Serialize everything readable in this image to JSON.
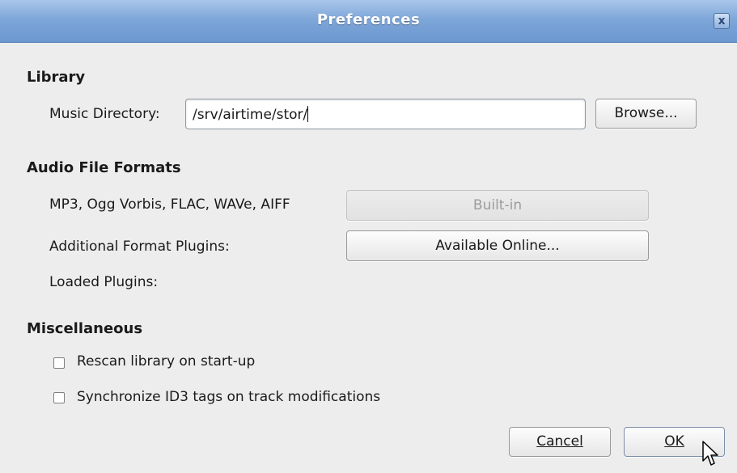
{
  "window": {
    "title": "Preferences",
    "close_icon": "x"
  },
  "library": {
    "heading": "Library",
    "music_dir_label": "Music Directory:",
    "music_dir_value": "/srv/airtime/stor/",
    "browse_label": "Browse..."
  },
  "audio": {
    "heading": "Audio File Formats",
    "formats_label": "MP3, Ogg Vorbis, FLAC, WAVe, AIFF",
    "builtin_label": "Built-in",
    "plugins_label": "Additional Format Plugins:",
    "available_online_label": "Available Online...",
    "loaded_plugins_label": "Loaded Plugins:"
  },
  "misc": {
    "heading": "Miscellaneous",
    "rescan_label": "Rescan library on start-up",
    "rescan_checked": false,
    "sync_id3_label": "Synchronize ID3 tags on track modifications",
    "sync_id3_checked": false
  },
  "footer": {
    "cancel_label": "Cancel",
    "ok_label": "OK"
  },
  "colors": {
    "titlebar": "#7ea7d9",
    "background": "#ededed"
  }
}
